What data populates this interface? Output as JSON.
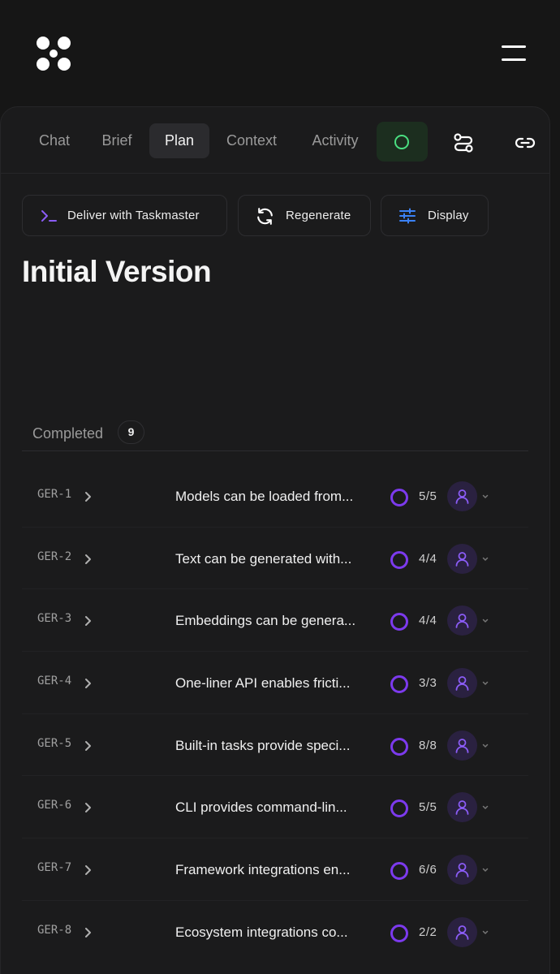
{
  "tabs": [
    {
      "label": "Chat"
    },
    {
      "label": "Brief"
    },
    {
      "label": "Plan"
    },
    {
      "label": "Context"
    },
    {
      "label": "Activity"
    }
  ],
  "active_tab": "Plan",
  "colors": {
    "accent": "#7c3aed",
    "status_active": "#4ade80",
    "background": "#161616"
  },
  "actions": {
    "deliver_label": "Deliver with Taskmaster",
    "regenerate_label": "Regenerate",
    "display_label": "Display"
  },
  "page": {
    "title": "Initial Version"
  },
  "section": {
    "label": "Completed",
    "count": "9"
  },
  "rows": [
    {
      "id": "GER-1",
      "title": "Models can be loaded from...",
      "count": "5/5"
    },
    {
      "id": "GER-2",
      "title": "Text can be generated with...",
      "count": "4/4"
    },
    {
      "id": "GER-3",
      "title": "Embeddings can be genera...",
      "count": "4/4"
    },
    {
      "id": "GER-4",
      "title": "One-liner API enables fricti...",
      "count": "3/3"
    },
    {
      "id": "GER-5",
      "title": "Built-in tasks provide speci...",
      "count": "8/8"
    },
    {
      "id": "GER-6",
      "title": "CLI provides command-lin...",
      "count": "5/5"
    },
    {
      "id": "GER-7",
      "title": "Framework integrations en...",
      "count": "6/6"
    },
    {
      "id": "GER-8",
      "title": "Ecosystem integrations co...",
      "count": "2/2"
    }
  ],
  "icons": {
    "logo": "logo-icon",
    "menu": "hamburger-menu-icon",
    "status": "status-circle-icon",
    "workflow": "workflow-icon",
    "link": "link-icon",
    "terminal": "terminal-icon",
    "refresh": "refresh-icon",
    "sliders": "sliders-icon",
    "chevron": "chevron-right-icon",
    "user": "user-icon"
  }
}
